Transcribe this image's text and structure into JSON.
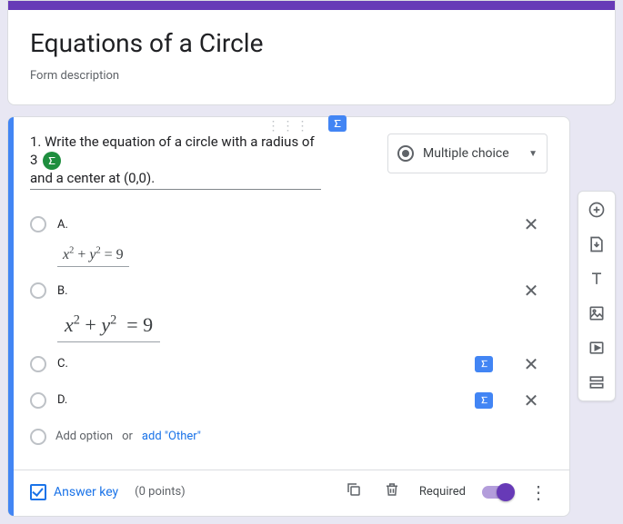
{
  "header": {
    "title": "Equations of a Circle",
    "description": "Form description"
  },
  "question": {
    "type_label": "Multiple choice",
    "prompt_prefix": "1. Write the equation of a circle with a radius of 3",
    "prompt_suffix": "and a center at (0,0).",
    "options": [
      {
        "label": "A."
      },
      {
        "label": "B."
      },
      {
        "label": "C."
      },
      {
        "label": "D."
      }
    ],
    "equation_a": "x² + y² = 9",
    "equation_b": "x² + y²  = 9",
    "add_option": "Add option",
    "or": "or",
    "add_other": "add \"Other\""
  },
  "footer": {
    "answer_key": "Answer key",
    "points": "(0 points)",
    "required": "Required"
  },
  "side": {
    "add": "add-question",
    "import": "import-questions",
    "title": "add-title",
    "image": "add-image",
    "video": "add-video",
    "section": "add-section"
  }
}
